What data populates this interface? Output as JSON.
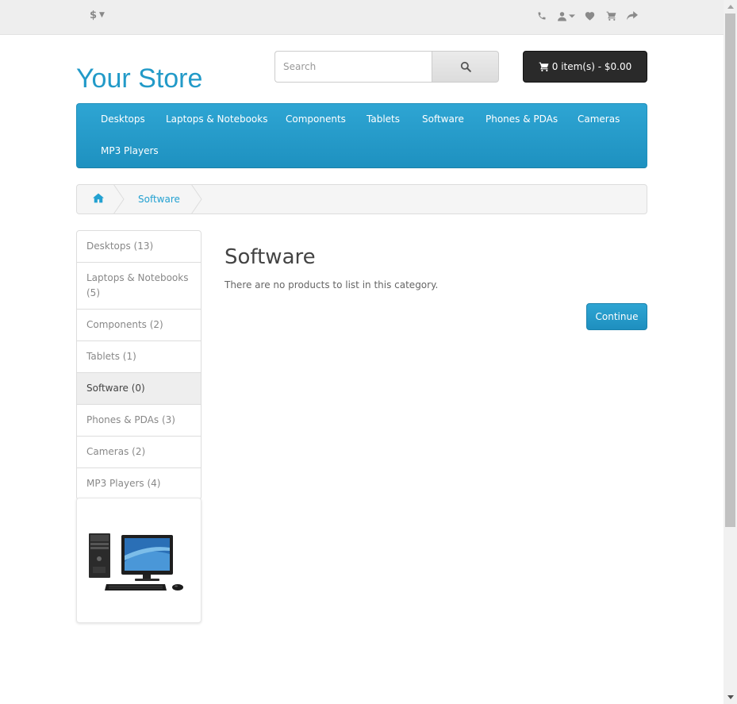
{
  "topbar": {
    "currency_symbol": "$",
    "icons": [
      "phone-icon",
      "user-icon",
      "heart-icon",
      "cart-icon",
      "share-icon"
    ]
  },
  "header": {
    "logo": "Your Store",
    "search": {
      "placeholder": "Search",
      "value": ""
    },
    "cart_label": "0 item(s) - $0.00"
  },
  "menu": {
    "items": [
      "Desktops",
      "Laptops & Notebooks",
      "Components",
      "Tablets",
      "Software",
      "Phones & PDAs",
      "Cameras",
      "MP3 Players"
    ]
  },
  "breadcrumb": {
    "items": [
      "Software"
    ]
  },
  "sidebar": {
    "categories": [
      {
        "label": "Desktops (13)",
        "active": false
      },
      {
        "label": "Laptops & Notebooks (5)",
        "active": false
      },
      {
        "label": "Components (2)",
        "active": false
      },
      {
        "label": "Tablets (1)",
        "active": false
      },
      {
        "label": "Software (0)",
        "active": true
      },
      {
        "label": "Phones & PDAs (3)",
        "active": false
      },
      {
        "label": "Cameras (2)",
        "active": false
      },
      {
        "label": "MP3 Players (4)",
        "active": false
      }
    ]
  },
  "content": {
    "title": "Software",
    "message": "There are no products to list in this category.",
    "continue_label": "Continue"
  },
  "colors": {
    "accent": "#229ac8",
    "menu_bg": "#229ac8",
    "cart_bg": "#2a2a2a",
    "active_bg": "#eeeeee"
  }
}
